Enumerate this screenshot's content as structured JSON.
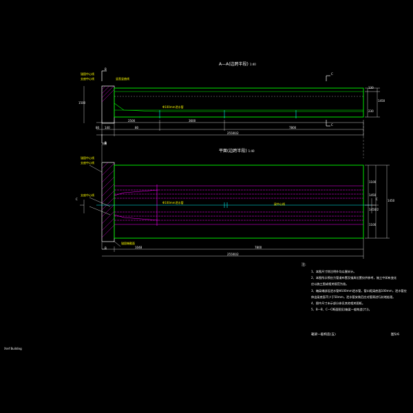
{
  "view_a": {
    "title": "A—A(边跨半段)",
    "scale": "1:40",
    "section_b_top": "B",
    "section_b_bottom": "B",
    "section_c_top": "C",
    "section_c_bottom": "C",
    "left_note_1": "锚固中心线",
    "left_note_2": "支座中心线",
    "end_label": "竖直竖曲线",
    "pipe_label": "Φ100mm泄水管",
    "dim_1": "2500",
    "dim_2": "3600",
    "dim_3": "7800",
    "dim_left_1": "80",
    "dim_left_2": "140",
    "dim_left_3": "80",
    "dim_total": "25500/2",
    "dim_vert_1": "130",
    "dim_vert_2": "1450",
    "dim_vert_3": "230",
    "dim_vert_4": "1500"
  },
  "view_plan": {
    "title": "平面(边跨半段)",
    "scale": "1:40",
    "section_b_top": "B",
    "section_b_bottom": "B",
    "section_c_top": "C",
    "section_c_bottom": "C",
    "left_note_1": "锚固中心线",
    "left_note_2": "支座中心线",
    "left_note_3": "支座中心线",
    "pipe_label": "Φ100mm泄水管",
    "center_label": "梁中心线",
    "bottom_label": "锚固端截面",
    "dim_1": "1048",
    "dim_2": "7800",
    "dim_total": "25500/2",
    "dim_vert_1": "1100",
    "dim_vert_2": "1450",
    "dim_vert_3": "1450/2",
    "dim_vert_4": "1100",
    "dim_vert_5": "1450"
  },
  "notes": {
    "heading": "注:",
    "items": [
      "1、本图尺寸除注明外均以厘米计。",
      "2、本图所示预应力管道布置及锚具位置仅供参考，施工中如有变化",
      "   应以施工图或相关规范为准。",
      "3、箱梁端部设泄水管Φ100mm泄水管，管口距梁底面100mm，泄水管应",
      "   伸出梁底面不少于50mm，泄水管安装后应对管周进行封堵处理。",
      "4、图中尺寸未示部分参见其他相关图纸。",
      "5、B—B、C—C断面图见(箱梁一般构造(六))。"
    ]
  },
  "footer": {
    "drawing_title": "箱梁一般构造(五)",
    "sheet": "图5/6"
  },
  "watermark": "Xref Building",
  "colors": {
    "background": "#000000",
    "outline": "#ffffff",
    "green": "#00ff00",
    "cyan": "#00ffff",
    "magenta": "#ff00ff",
    "yellow": "#ffff00"
  }
}
